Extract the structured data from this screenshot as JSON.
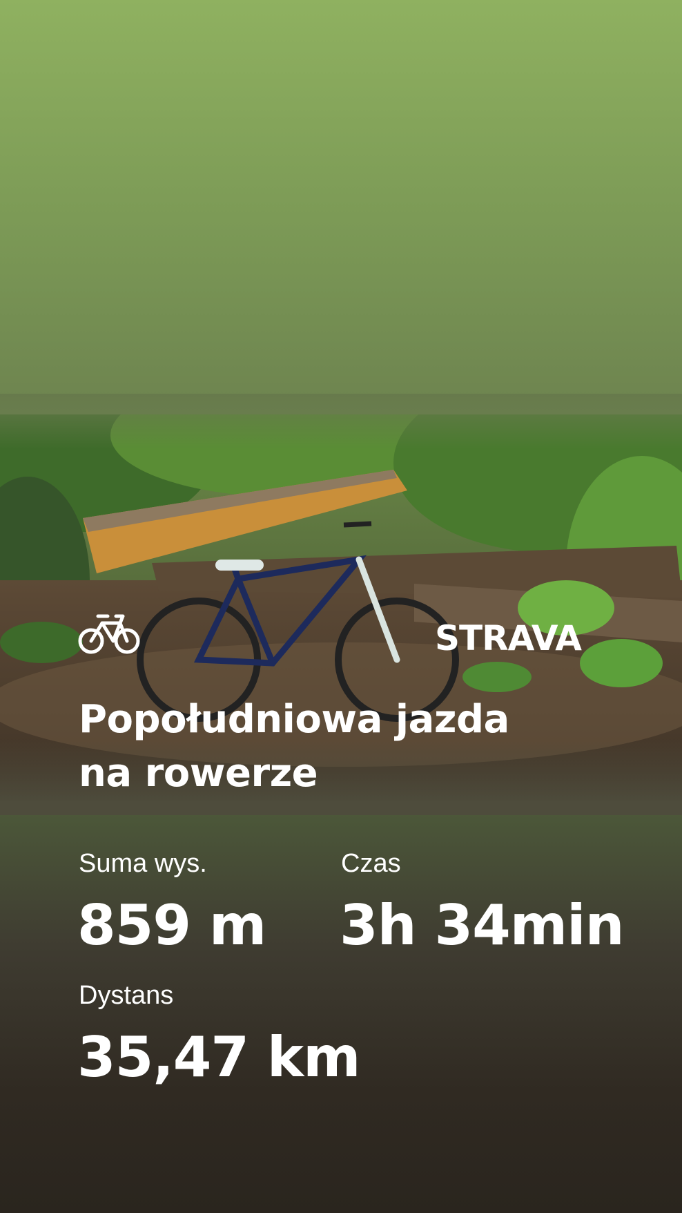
{
  "brand": {
    "name": "STRAVA"
  },
  "activity": {
    "icon": "bicycle-icon",
    "title_line1": "Popołudniowa jazda",
    "title_line2": "na rowerze"
  },
  "stats": [
    {
      "label": "Suma wys.",
      "value": "859 m"
    },
    {
      "label": "Czas",
      "value": "3h 34min"
    },
    {
      "label": "Dystans",
      "value": "35,47 km"
    }
  ],
  "photo": {
    "subject": "bicycle-photo"
  }
}
